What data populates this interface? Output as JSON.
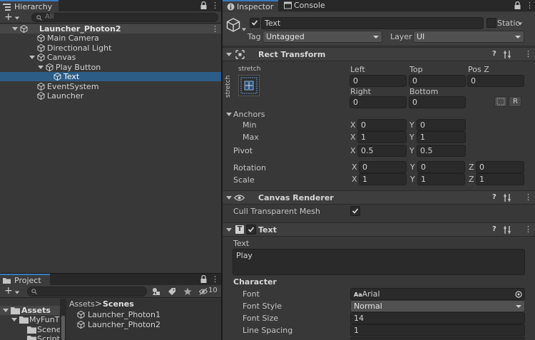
{
  "hierarchy": {
    "tab_label": "Hierarchy",
    "search_placeholder": "All",
    "add_label": "+",
    "lock_icon": "lock-icon",
    "menu_icon": "⋮",
    "scene_name": "Launcher_Photon2",
    "items": [
      {
        "label": "Main Camera"
      },
      {
        "label": "Directional Light"
      },
      {
        "label": "Canvas"
      },
      {
        "label": "Play Button"
      },
      {
        "label": "Text"
      },
      {
        "label": "EventSystem"
      },
      {
        "label": "Launcher"
      }
    ]
  },
  "project": {
    "tab_label": "Project",
    "add_label": "+",
    "hidden_count": "10",
    "breadcrumb_root": "Assets",
    "breadcrumb_current": "Scenes",
    "tree": [
      {
        "label": "Assets"
      },
      {
        "label": "MyFunT"
      },
      {
        "label": "Scene"
      },
      {
        "label": "Script"
      }
    ],
    "files": [
      {
        "label": "Launcher_Photon1"
      },
      {
        "label": "Launcher_Photon2"
      }
    ]
  },
  "inspector": {
    "tab_inspector": "Inspector",
    "tab_console": "Console",
    "object_name": "Text",
    "static_label": "Static",
    "tag_label": "Tag",
    "tag_value": "Untagged",
    "layer_label": "Layer",
    "layer_value": "UI",
    "rect_transform": {
      "title": "Rect Transform",
      "stretch_h": "stretch",
      "stretch_v": "stretch",
      "left_label": "Left",
      "left_value": "0",
      "top_label": "Top",
      "top_value": "0",
      "posz_label": "Pos Z",
      "posz_value": "0",
      "right_label": "Right",
      "right_value": "0",
      "bottom_label": "Bottom",
      "bottom_value": "0",
      "anchors_label": "Anchors",
      "min_label": "Min",
      "min_x": "0",
      "min_y": "0",
      "max_label": "Max",
      "max_x": "1",
      "max_y": "1",
      "pivot_label": "Pivot",
      "pivot_x": "0.5",
      "pivot_y": "0.5",
      "rotation_label": "Rotation",
      "rot_x": "0",
      "rot_y": "0",
      "rot_z": "0",
      "scale_label": "Scale",
      "scale_x": "1",
      "scale_y": "1",
      "scale_z": "1",
      "x": "X",
      "y": "Y",
      "z": "Z",
      "r_button": "R"
    },
    "canvas_renderer": {
      "title": "Canvas Renderer",
      "cull_label": "Cull Transparent Mesh"
    },
    "text_component": {
      "title": "Text",
      "icon_letter": "T",
      "text_label": "Text",
      "text_value": "Play",
      "character_label": "Character",
      "font_label": "Font",
      "font_value": "Arial",
      "font_prefix": "Aa",
      "font_style_label": "Font Style",
      "font_style_value": "Normal",
      "font_size_label": "Font Size",
      "font_size_value": "14",
      "line_spacing_label": "Line Spacing",
      "line_spacing_value": "1"
    }
  },
  "colors": {
    "selection": "#2c5d87",
    "tab_accent": "#3a79bb",
    "panel_bg": "#383838"
  }
}
